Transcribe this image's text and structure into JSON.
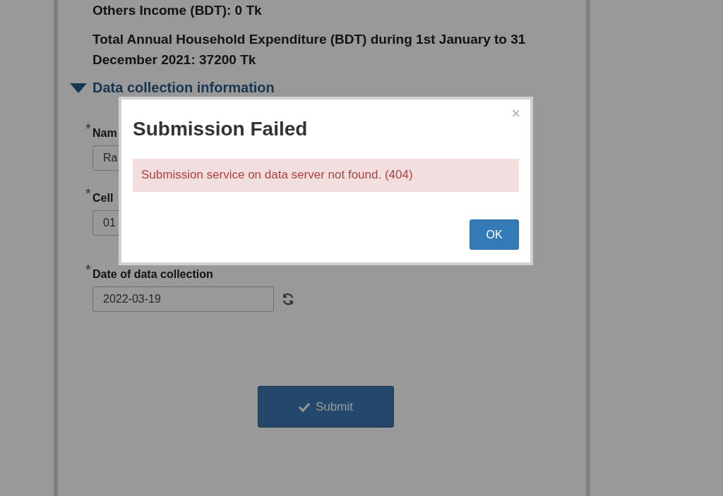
{
  "page": {
    "summary": [
      "Others Income (BDT): 0 Tk",
      "Total Annual Household Expenditure (BDT) during 1st January to 31 December 2021: 37200 Tk"
    ],
    "section": {
      "title": "Data collection information",
      "expanded": true
    },
    "fields": [
      {
        "kind": "text",
        "mark": "*",
        "label": "Nam",
        "value": "Ra"
      },
      {
        "kind": "text",
        "mark": "*",
        "label": "Cell",
        "value": "01"
      },
      {
        "kind": "date",
        "mark": "*",
        "label": "Date of data collection",
        "value": "2022-03-19"
      }
    ],
    "submit": "Submit"
  },
  "dialog": {
    "title": "Submission Failed",
    "close": "×",
    "message": "Submission service on data server not found. (404)",
    "button": "OK"
  }
}
